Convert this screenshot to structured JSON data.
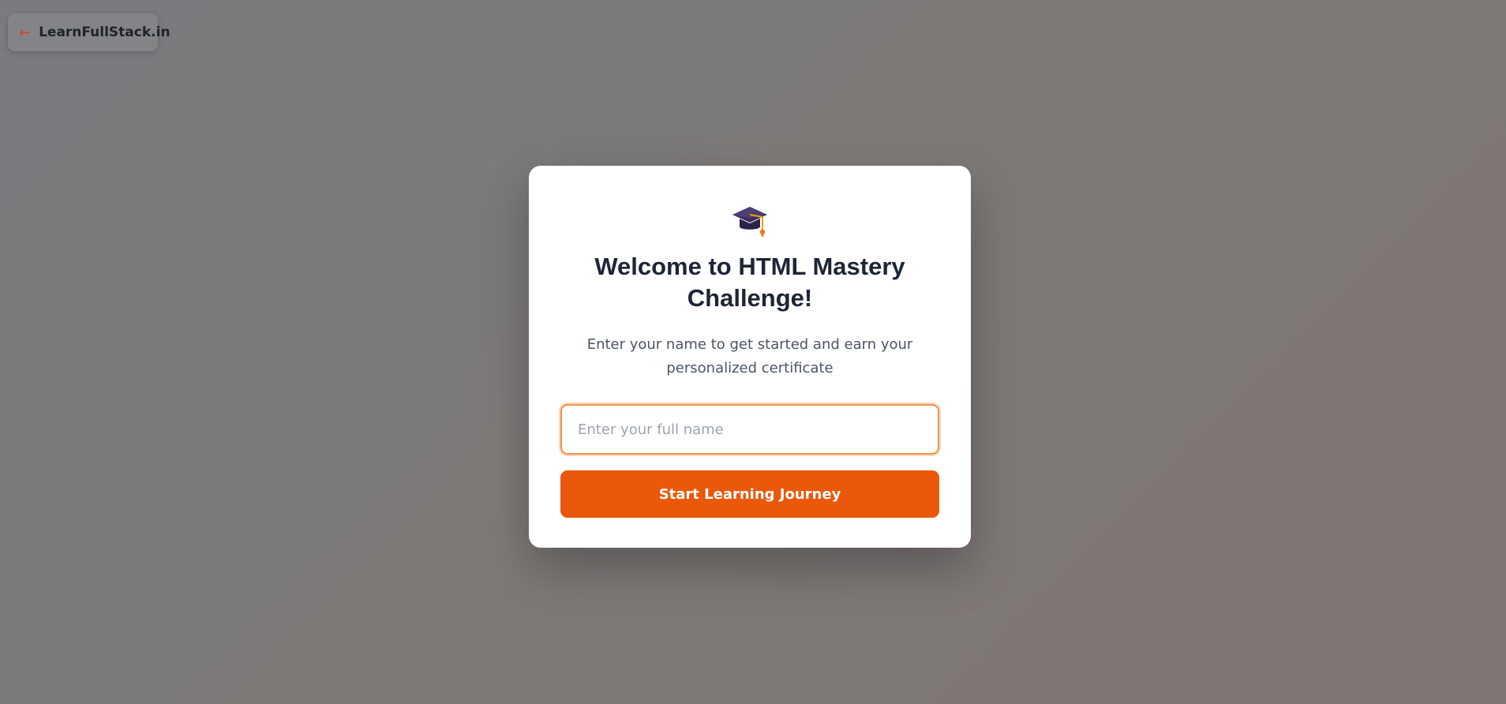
{
  "nav": {
    "back_arrow": "←",
    "back_label": "LearnFullStack.in"
  },
  "modal": {
    "icon": "graduation-cap-icon",
    "title": "Welcome to HTML Mastery Challenge!",
    "subtitle": "Enter your name to get started and earn your personalized certificate",
    "input": {
      "value": "",
      "placeholder": "Enter your full name"
    },
    "button_label": "Start Learning Journey"
  },
  "colors": {
    "accent": "#ea580c",
    "input_focus_border": "#f5924a",
    "title": "#1d2535",
    "subtitle": "#4b5563"
  }
}
